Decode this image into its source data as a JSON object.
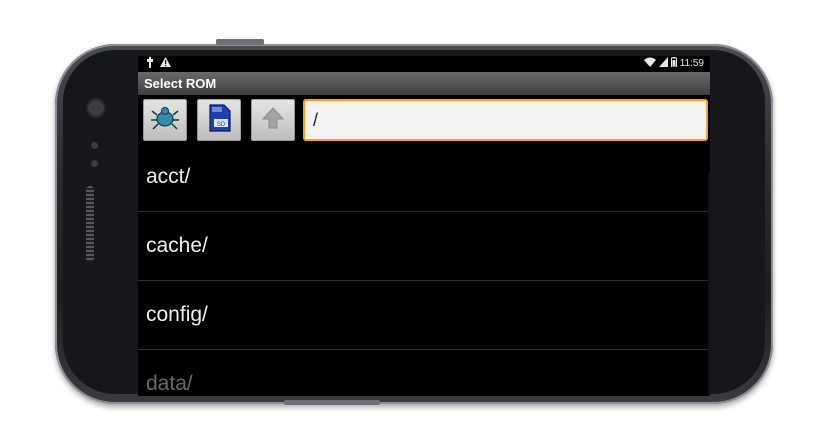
{
  "status": {
    "time": "11:59"
  },
  "dialog": {
    "title": "Select ROM"
  },
  "toolbar": {
    "path_value": "/"
  },
  "files": [
    {
      "name": "acct/"
    },
    {
      "name": "cache/"
    },
    {
      "name": "config/"
    },
    {
      "name": "data/"
    }
  ],
  "icons": {
    "status_left": [
      "usb-icon",
      "warning-icon"
    ],
    "status_right": [
      "wifi-icon",
      "signal-icon",
      "battery-icon"
    ],
    "toolbar": [
      "bug-icon",
      "sd-card-icon",
      "up-arrow-icon"
    ]
  },
  "colors": {
    "accent": "#f7a11a",
    "title_bar": "#4f4f4f"
  }
}
